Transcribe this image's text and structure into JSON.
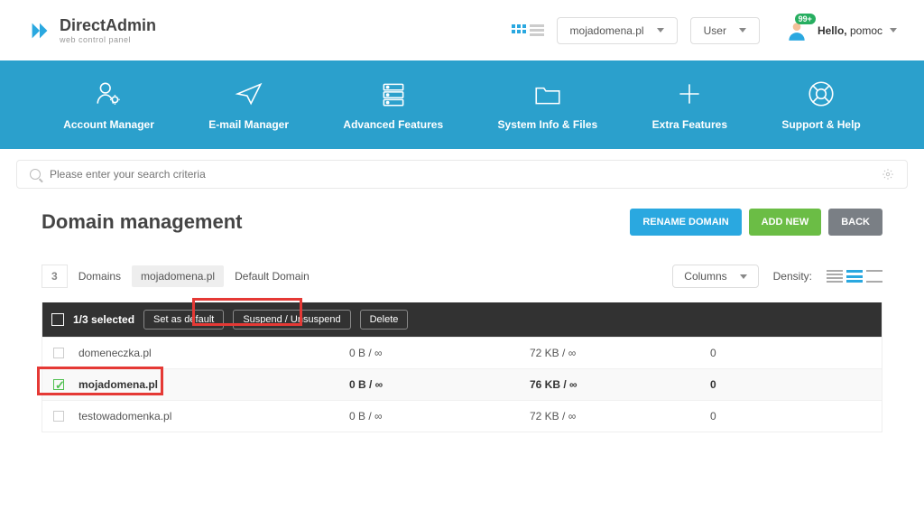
{
  "brand": {
    "name": "DirectAdmin",
    "tagline": "web control panel"
  },
  "header": {
    "domain_selector": "mojadomena.pl",
    "role_selector": "User",
    "greeting_prefix": "Hello,",
    "greeting_user": "pomoc",
    "notification_badge": "99+"
  },
  "nav": [
    {
      "label": "Account Manager"
    },
    {
      "label": "E-mail Manager"
    },
    {
      "label": "Advanced Features"
    },
    {
      "label": "System Info & Files"
    },
    {
      "label": "Extra Features"
    },
    {
      "label": "Support & Help"
    }
  ],
  "search": {
    "placeholder": "Please enter your search criteria"
  },
  "page": {
    "title": "Domain management",
    "rename_btn": "RENAME DOMAIN",
    "addnew_btn": "ADD NEW",
    "back_btn": "BACK"
  },
  "meta": {
    "count": "3",
    "count_label": "Domains",
    "chip": "mojadomena.pl",
    "chip_label": "Default Domain",
    "columns_label": "Columns",
    "density_label": "Density:"
  },
  "actionbar": {
    "selected": "1/3 selected",
    "set_default": "Set as default",
    "suspend": "Suspend / Unsuspend",
    "delete": "Delete"
  },
  "rows": [
    {
      "name": "domeneczka.pl",
      "bw": "0 B / ∞",
      "disk": "72 KB / ∞",
      "other": "0",
      "selected": false
    },
    {
      "name": "mojadomena.pl",
      "bw": "0 B / ∞",
      "disk": "76 KB / ∞",
      "other": "0",
      "selected": true
    },
    {
      "name": "testowadomenka.pl",
      "bw": "0 B / ∞",
      "disk": "72 KB / ∞",
      "other": "0",
      "selected": false
    }
  ]
}
